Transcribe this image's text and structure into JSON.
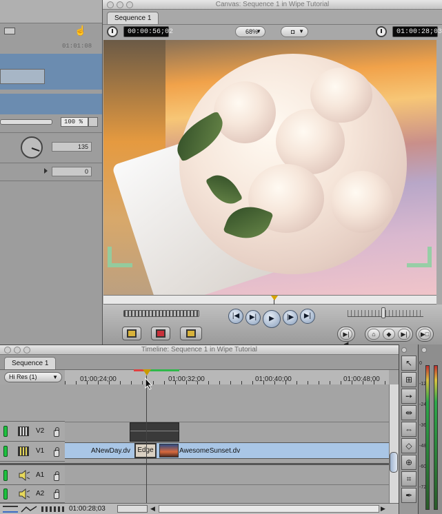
{
  "left_viewer": {
    "timecode_faded": "01:01:08",
    "scale_value": "100 %",
    "rotation_value": "135",
    "center_value": "0"
  },
  "canvas": {
    "title": "Canvas: Sequence 1 in Wipe Tutorial",
    "tab": "Sequence 1",
    "duration_tc": "00:00:56;02",
    "zoom": "68%",
    "current_tc": "01:00:28;03"
  },
  "timeline": {
    "title": "Timeline: Sequence 1 in Wipe Tutorial",
    "tab": "Sequence 1",
    "render_quality": "Hi Res  (1)",
    "ruler_labels": [
      "01:00:24;00",
      "01:00:32;00",
      "01:00:40;00",
      "01:00:48;00"
    ],
    "tracks": {
      "v2": "V2",
      "v1": "V1",
      "a1": "A1",
      "a2": "A2"
    },
    "clips": {
      "clip_a": "ANewDay.dv",
      "transition": "Edge",
      "clip_b": "AwesomeSunset.dv"
    },
    "current_tc": "01:00:28;03"
  },
  "meters": {
    "labels": [
      "0",
      "-12",
      "-24",
      "-36",
      "-48",
      "-60",
      "-72"
    ]
  },
  "colors": {
    "clip_blue": "#a9c6e6",
    "track_toggle_green": "#1fc040",
    "playhead": "#c89a00",
    "render_red": "#e04040",
    "render_green": "#2fb84a"
  }
}
